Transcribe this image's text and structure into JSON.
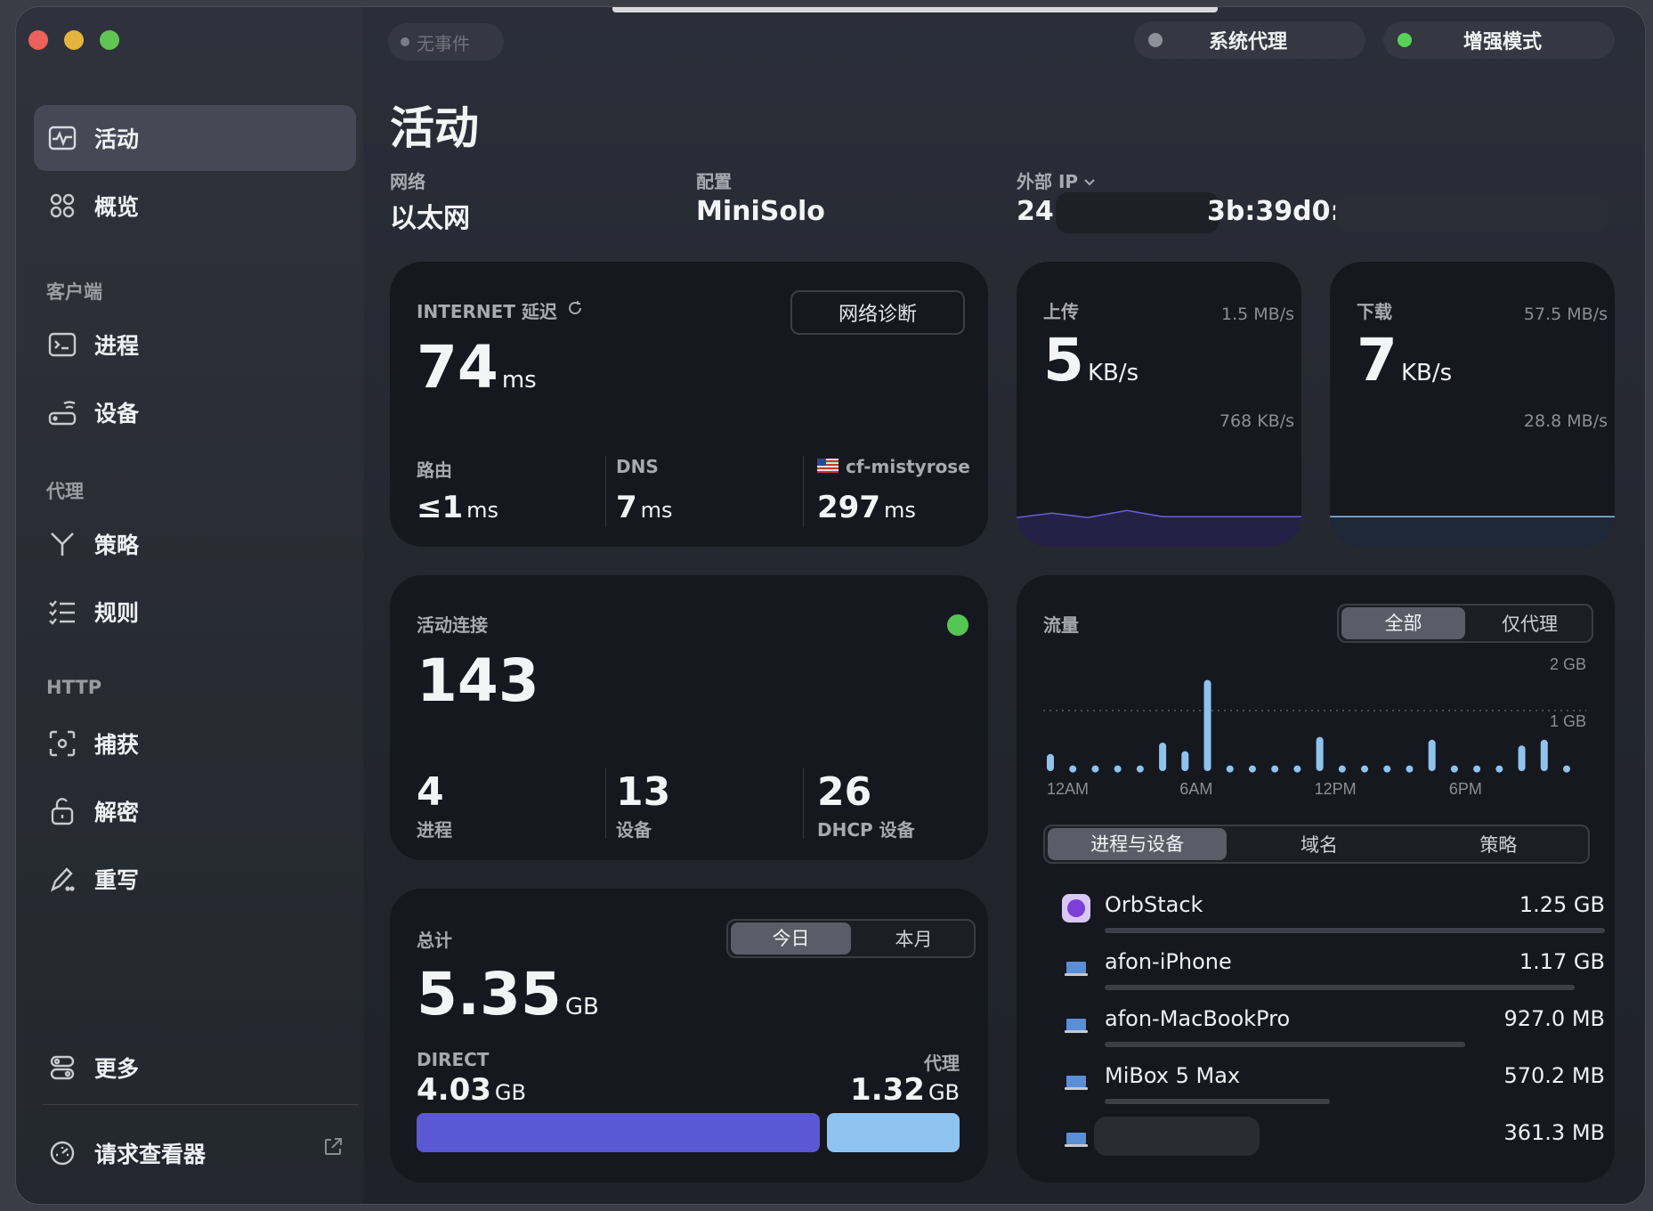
{
  "status_pill": "无事件",
  "system_proxy": "系统代理",
  "enhanced_mode": "增强模式",
  "sidebar": {
    "activity": "活动",
    "overview": "概览",
    "section_client": "客户端",
    "process": "进程",
    "device": "设备",
    "section_proxy": "代理",
    "policy": "策略",
    "rules": "规则",
    "section_http": "HTTP",
    "capture": "捕获",
    "decrypt": "解密",
    "rewrite": "重写",
    "more": "更多",
    "request_viewer": "请求查看器"
  },
  "header": {
    "title": "活动",
    "network_label": "网络",
    "network_value": "以太网",
    "config_label": "配置",
    "config_value": "MiniSolo",
    "ip_label": "外部 IP",
    "ip_prefix": "24(",
    "ip_middle": "3b:39d0:"
  },
  "latency": {
    "title": "INTERNET 延迟",
    "diag_button": "网络诊断",
    "value": "74",
    "unit": "ms",
    "router_label": "路由",
    "router_value": "≤1",
    "dns_label": "DNS",
    "dns_value": "7",
    "proxy_label": "cf-mistyrose",
    "proxy_value": "297",
    "ms": "ms"
  },
  "upload": {
    "label": "上传",
    "value": "5",
    "unit": "KB/s",
    "max": "1.5 MB/s",
    "mid": "768 KB/s"
  },
  "download": {
    "label": "下载",
    "value": "7",
    "unit": "KB/s",
    "max": "57.5 MB/s",
    "mid": "28.8 MB/s"
  },
  "connections": {
    "title": "活动连接",
    "value": "143",
    "proc_value": "4",
    "proc_label": "进程",
    "dev_value": "13",
    "dev_label": "设备",
    "dhcp_value": "26",
    "dhcp_label": "DHCP 设备"
  },
  "total": {
    "title": "总计",
    "tab_today": "今日",
    "tab_month": "本月",
    "value": "5.35",
    "unit": "GB",
    "direct_label": "DIRECT",
    "direct_value": "4.03",
    "proxy_label": "代理",
    "proxy_value": "1.32",
    "direct_share": 0.753
  },
  "traffic": {
    "title": "流量",
    "tab_all": "全部",
    "tab_proxy_only": "仅代理",
    "y_2gb": "2 GB",
    "y_1gb": "1 GB",
    "x_labels": [
      "12AM",
      "6AM",
      "12PM",
      "6PM"
    ],
    "tab_proc_dev": "进程与设备",
    "tab_domain": "域名",
    "tab_policy": "策略",
    "items": [
      {
        "name": "OrbStack",
        "value": "1.25 GB",
        "share": 1.0
      },
      {
        "name": "afon-iPhone",
        "value": "1.17 GB",
        "share": 0.94
      },
      {
        "name": "afon-MacBookPro",
        "value": "927.0 MB",
        "share": 0.72
      },
      {
        "name": "MiBox 5 Max",
        "value": "570.2 MB",
        "share": 0.45
      },
      {
        "name": "",
        "value": "361.3 MB",
        "share": 0.3
      }
    ]
  },
  "chart_data": {
    "type": "bar",
    "categories": [
      "0",
      "1",
      "2",
      "3",
      "4",
      "5",
      "6",
      "7",
      "8",
      "9",
      "10",
      "11",
      "12",
      "13",
      "14",
      "15",
      "16",
      "17",
      "18",
      "19",
      "20",
      "21",
      "22",
      "23"
    ],
    "values": [
      0.3,
      0.1,
      0.1,
      0.1,
      0.1,
      0.5,
      0.35,
      1.6,
      0.1,
      0.1,
      0.1,
      0.1,
      0.6,
      0.1,
      0.1,
      0.1,
      0.1,
      0.55,
      0.1,
      0.1,
      0.1,
      0.45,
      0.55,
      0.1
    ],
    "ylim": [
      0,
      2
    ],
    "colors": {
      "bar": "#8fc3ee",
      "upload_line": "#6a5fd6",
      "download_line": "#8fc3ee",
      "direct": "#5b58d6",
      "proxy": "#8ec4ef"
    }
  }
}
